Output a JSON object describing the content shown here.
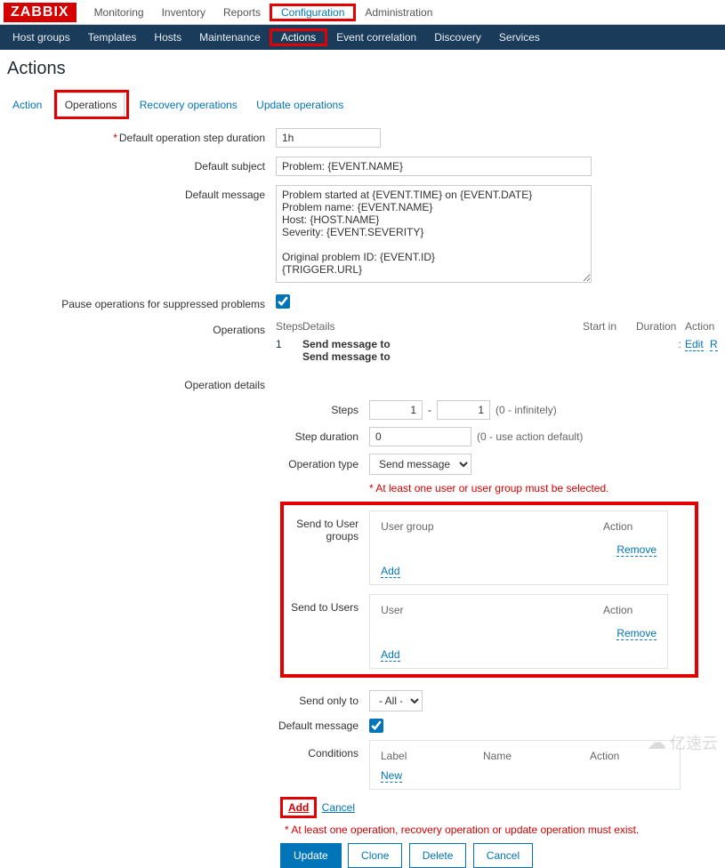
{
  "brand": "ZABBIX",
  "topnav": {
    "items": [
      {
        "label": "Monitoring"
      },
      {
        "label": "Inventory"
      },
      {
        "label": "Reports"
      },
      {
        "label": "Configuration",
        "active": true
      },
      {
        "label": "Administration"
      }
    ]
  },
  "subnav": {
    "items": [
      {
        "label": "Host groups"
      },
      {
        "label": "Templates"
      },
      {
        "label": "Hosts"
      },
      {
        "label": "Maintenance"
      },
      {
        "label": "Actions",
        "active": true
      },
      {
        "label": "Event correlation"
      },
      {
        "label": "Discovery"
      },
      {
        "label": "Services"
      }
    ]
  },
  "page_title": "Actions",
  "tabs": {
    "items": [
      {
        "label": "Action"
      },
      {
        "label": "Operations",
        "active": true
      },
      {
        "label": "Recovery operations"
      },
      {
        "label": "Update operations"
      }
    ]
  },
  "form": {
    "default_step_duration": {
      "label": "Default operation step duration",
      "value": "1h",
      "required": true
    },
    "default_subject": {
      "label": "Default subject",
      "value": "Problem: {EVENT.NAME}"
    },
    "default_message": {
      "label": "Default message",
      "value": "Problem started at {EVENT.TIME} on {EVENT.DATE}\nProblem name: {EVENT.NAME}\nHost: {HOST.NAME}\nSeverity: {EVENT.SEVERITY}\n\nOriginal problem ID: {EVENT.ID}\n{TRIGGER.URL}"
    },
    "pause_suppressed": {
      "label": "Pause operations for suppressed problems",
      "checked": true
    },
    "operations_label": "Operations",
    "operations_header": {
      "steps": "Steps",
      "details": "Details",
      "start": "Start in",
      "duration": "Duration",
      "action": "Action"
    },
    "operations_row": {
      "step": "1",
      "line1": "Send message to",
      "line2": "Send message to",
      "colon": ":",
      "edit": "Edit",
      "remove": "R"
    },
    "op_details_label": "Operation details",
    "steps": {
      "label": "Steps",
      "from": "1",
      "to": "1",
      "hint": "(0 - infinitely)"
    },
    "step_duration": {
      "label": "Step duration",
      "value": "0",
      "hint": "(0 - use action default)"
    },
    "operation_type": {
      "label": "Operation type",
      "value": "Send message"
    },
    "must_select_note": "At least one user or user group must be selected.",
    "user_groups": {
      "label": "Send to User groups",
      "col1": "User group",
      "col2": "Action",
      "remove": "Remove",
      "add": "Add"
    },
    "users": {
      "label": "Send to Users",
      "col1": "User",
      "col2": "Action",
      "remove": "Remove",
      "add": "Add"
    },
    "send_only_to": {
      "label": "Send only to",
      "value": "- All -"
    },
    "default_message_chk": {
      "label": "Default message",
      "checked": true
    },
    "conditions": {
      "label": "Conditions",
      "col1": "Label",
      "col2": "Name",
      "col3": "Action",
      "new": "New"
    },
    "add_cancel": {
      "add": "Add",
      "cancel": "Cancel"
    },
    "footer_note": "At least one operation, recovery operation or update operation must exist.",
    "buttons": {
      "update": "Update",
      "clone": "Clone",
      "delete": "Delete",
      "cancel": "Cancel"
    }
  },
  "watermark": "亿速云"
}
